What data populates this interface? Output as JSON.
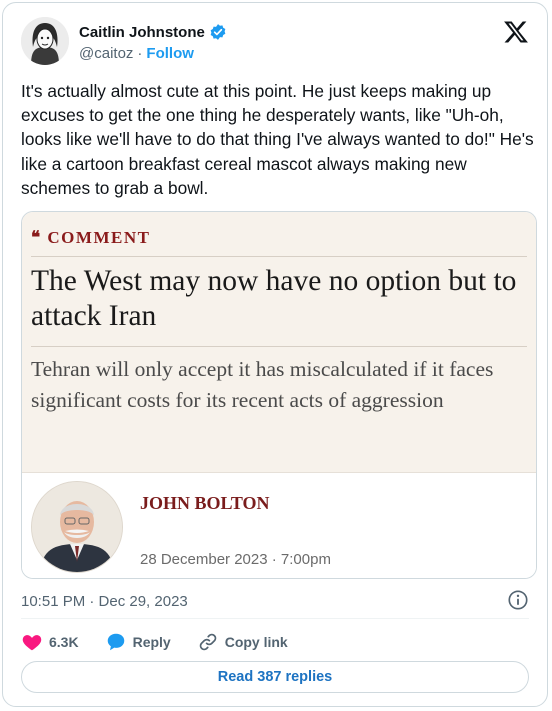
{
  "user": {
    "display_name": "Caitlin Johnstone",
    "handle": "@caitoz",
    "separator": "·",
    "follow_label": "Follow",
    "verified_icon": "verified-badge-icon",
    "avatar_icon": "avatar-portrait"
  },
  "brand_icon": "x-logo-icon",
  "tweet": {
    "text": "It's actually almost cute at this point. He just keeps making up excuses to get the one thing he desperately wants, like \"Uh-oh, looks like we'll have to do that thing I've always wanted to do!\" He's like a cartoon breakfast cereal mascot always making new schemes to grab a bowl."
  },
  "quote_card": {
    "kicker": "COMMENT",
    "kicker_glyph": "❝",
    "headline": "The West may now have no option but to attack Iran",
    "standfirst": "Tehran will only accept it has miscalculated if it faces significant costs for its recent acts of aggression",
    "author_name": "JOHN BOLTON",
    "author_date": "28 December 2023 · 7:00pm",
    "author_photo": "author-portrait",
    "colors": {
      "kicker": "#8a1b1b",
      "author": "#7a1c1c",
      "top_bg": "#f7f2eb"
    }
  },
  "meta": {
    "timestamp": "10:51 PM · Dec 29, 2023",
    "info_icon": "info-icon"
  },
  "actions": {
    "likes": "6.3K",
    "reply_label": "Reply",
    "copy_link_label": "Copy link"
  },
  "read_replies_label": "Read 387 replies",
  "colors": {
    "accent": "#1d9bf0",
    "like": "#f91880",
    "text": "#0f1419",
    "muted": "#536471"
  }
}
